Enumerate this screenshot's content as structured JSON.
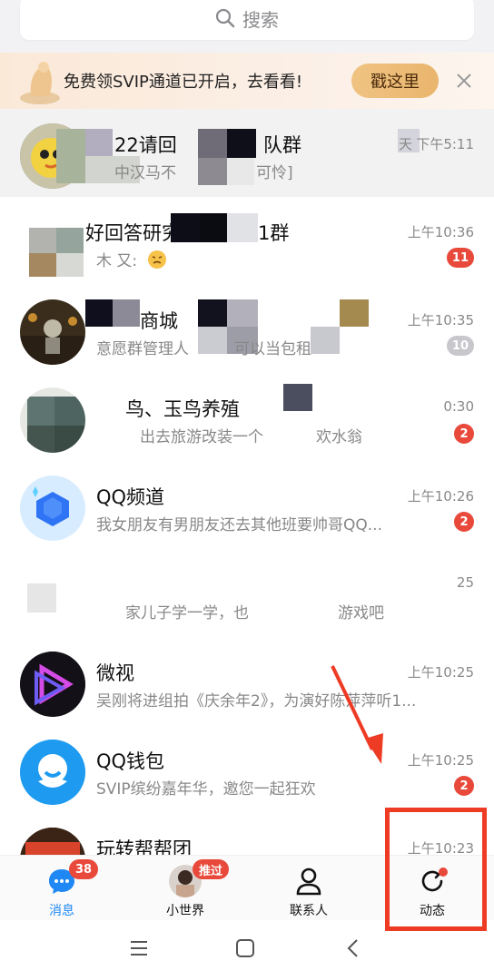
{
  "search": {
    "placeholder": "搜索"
  },
  "banner": {
    "text": "免费领SVIP通道已开启，去看看!",
    "button": "戳这里"
  },
  "rows": [
    {
      "title": "22请回",
      "title_tail": "队群",
      "preview_a": "中汉马不",
      "preview_b": "可怜]",
      "time": "下午5:11",
      "time_prefix": "天",
      "badge": ""
    },
    {
      "title": "好回答研究",
      "title_tail": "1群",
      "preview_a": "木 又:",
      "preview_b": "",
      "time": "上午10:36",
      "badge": "11"
    },
    {
      "title": "商城",
      "title_tail": "",
      "preview_a": "意愿群管理人",
      "preview_b": "可以当包租",
      "time": "上午10:35",
      "badge": "10"
    },
    {
      "title": "鸟、玉鸟养殖",
      "title_tail": "",
      "preview_a": "出去旅游改装一个",
      "preview_b": "欢水翁",
      "time": "0:30",
      "badge": "2"
    },
    {
      "title": "QQ频道",
      "title_tail": "",
      "preview_a": "我女朋友有男朋友还去其他班要帅哥QQ...",
      "preview_b": "",
      "time": "上午10:26",
      "badge": "2"
    },
    {
      "title": "",
      "title_tail": "",
      "preview_a": "家儿子学一学，也",
      "preview_b": "游戏吧",
      "time": "25",
      "badge": ""
    },
    {
      "title": "微视",
      "title_tail": "",
      "preview_a": "吴刚将进组拍《庆余年2》，为演好陈萍萍听1...",
      "preview_b": "",
      "time": "上午10:25",
      "badge": ""
    },
    {
      "title": "QQ钱包",
      "title_tail": "",
      "preview_a": "SVIP缤纷嘉年华，邀您一起狂欢",
      "preview_b": "",
      "time": "上午10:25",
      "badge": "2"
    },
    {
      "title": "玩转帮帮团",
      "title_tail": "",
      "preview_a": "",
      "preview_b": "",
      "time": "上午10:23",
      "badge": ""
    }
  ],
  "nav": {
    "messages": {
      "label": "消息",
      "badge": "38"
    },
    "small_world": {
      "label": "小世界",
      "badge": "推过"
    },
    "contacts": {
      "label": "联系人"
    },
    "moments": {
      "label": "动态"
    }
  },
  "colors": {
    "accent": "#1f88f5",
    "badge": "#e8493a",
    "annotation": "#ee3b24"
  }
}
